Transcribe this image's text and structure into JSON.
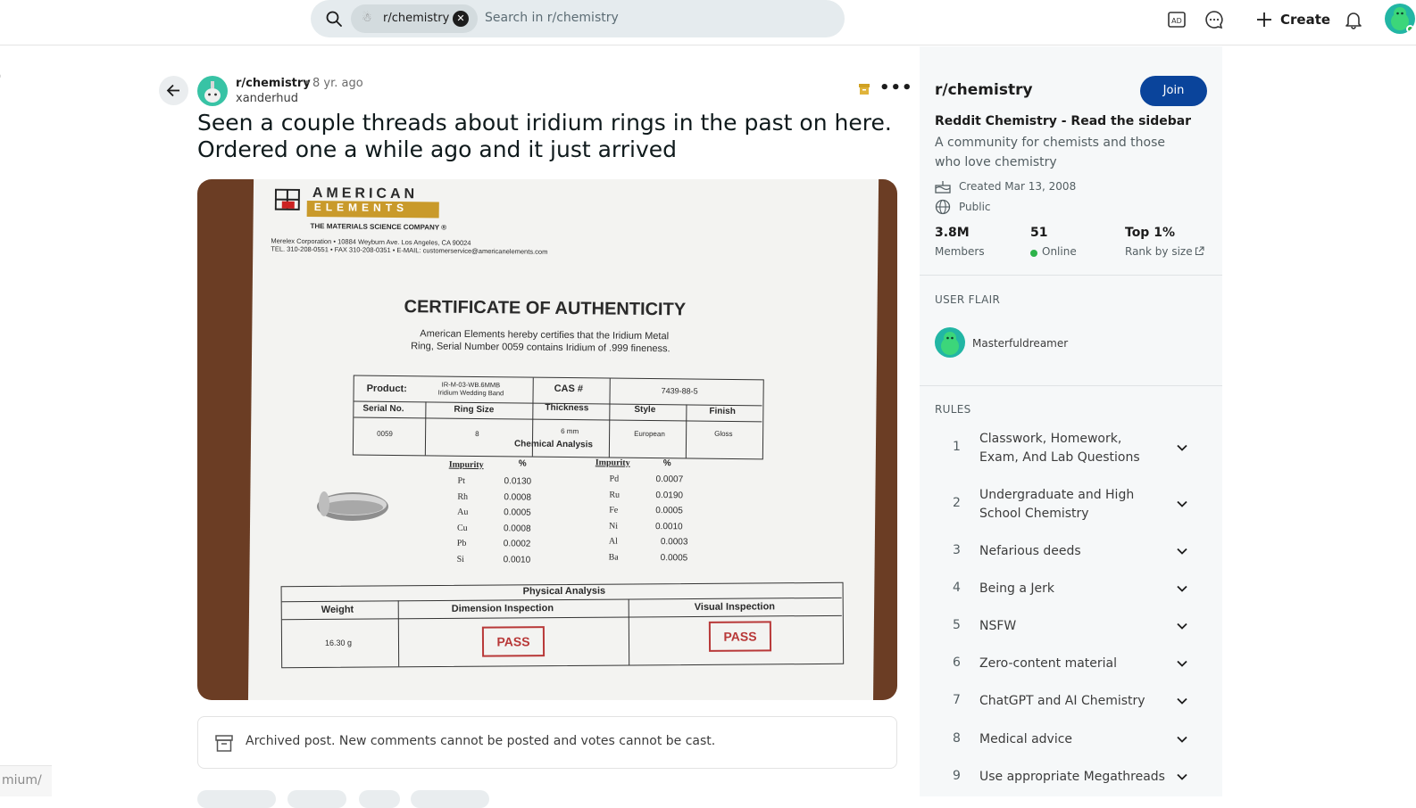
{
  "search": {
    "chip_label": "r/chemistry",
    "placeholder": "Search in r/chemistry"
  },
  "topbar": {
    "create_label": "Create",
    "icons": [
      "advertise-icon",
      "chat-icon",
      "plus-icon",
      "notification-bell-icon",
      "user-avatar"
    ]
  },
  "left_fragment": ")",
  "url_fragment": "mium/",
  "post": {
    "subreddit": "r/chemistry",
    "separator": "•",
    "age": "8 yr. ago",
    "author": "xanderhud",
    "title": "Seen a couple threads about iridium rings in the past on here. Ordered one a while ago and it just arrived",
    "archived_notice": "Archived post. New comments cannot be posted and votes cannot be cast."
  },
  "certificate": {
    "company_line1": "AMERICAN",
    "company_line2": "ELEMENTS",
    "tagline": "THE MATERIALS SCIENCE COMPANY ®",
    "address1": "Merelex Corporation  •  10884 Weyburn Ave. Los Angeles, CA 90024",
    "address2": "TEL. 310-208-0551 •  FAX 310-208-0351 • E-MAIL: customerservice@americanelements.com",
    "heading": "CERTIFICATE OF AUTHENTICITY",
    "statement1": "American Elements hereby certifies that the Iridium Metal",
    "statement2": "Ring, Serial Number 0059 contains Iridium of .999 fineness.",
    "product_label": "Product:",
    "product_value1": "IR-M-03-WB.6MMB",
    "product_value2": "Iridium Wedding Band",
    "cas_label": "CAS #",
    "cas_value": "7439-88-5",
    "headers": [
      "Serial No.",
      "Ring Size",
      "Thickness",
      "Style",
      "Finish"
    ],
    "values": [
      "0059",
      "8",
      "6 mm",
      "European",
      "Gloss"
    ],
    "chem_title": "Chemical Analysis",
    "impurity_label": "Impurity",
    "percent_label": "%",
    "impurities_left": [
      [
        "Pt",
        "0.0130"
      ],
      [
        "Rh",
        "0.0008"
      ],
      [
        "Au",
        "0.0005"
      ],
      [
        "Cu",
        "0.0008"
      ],
      [
        "Pb",
        "0.0002"
      ],
      [
        "Si",
        "0.0010"
      ]
    ],
    "impurities_right": [
      [
        "Pd",
        "0.0007"
      ],
      [
        "Ru",
        "0.0190"
      ],
      [
        "Fe",
        "0.0005"
      ],
      [
        "Ni",
        "0.0010"
      ],
      [
        "Al",
        "0.0003"
      ],
      [
        "Ba",
        "0.0005"
      ]
    ],
    "phys_title": "Physical Analysis",
    "weight_label": "Weight",
    "weight_value": "16.30 g",
    "dim_label": "Dimension Inspection",
    "vis_label": "Visual Inspection",
    "pass": "PASS"
  },
  "sidebar": {
    "name": "r/chemistry",
    "join_label": "Join",
    "title": "Reddit Chemistry - Read the sidebar",
    "description": "A community for chemists and those who love chemistry",
    "created": "Created Mar 13, 2008",
    "visibility": "Public",
    "members_value": "3.8M",
    "members_label": "Members",
    "online_value": "51",
    "online_label": "Online",
    "rank_value": "Top 1%",
    "rank_label": "Rank by size",
    "flair_heading": "USER FLAIR",
    "flair_user": "Masterfuldreamer",
    "rules_heading": "RULES",
    "rules": [
      {
        "num": "1",
        "text": "Classwork, Homework, Exam, And Lab Questions"
      },
      {
        "num": "2",
        "text": "Undergraduate and High School Chemistry"
      },
      {
        "num": "3",
        "text": "Nefarious deeds"
      },
      {
        "num": "4",
        "text": "Being a Jerk"
      },
      {
        "num": "5",
        "text": "NSFW"
      },
      {
        "num": "6",
        "text": "Zero-content material"
      },
      {
        "num": "7",
        "text": "ChatGPT and AI Chemistry"
      },
      {
        "num": "8",
        "text": "Medical advice"
      },
      {
        "num": "9",
        "text": "Use appropriate Megathreads"
      }
    ]
  },
  "colors": {
    "join_bg": "#0a449b",
    "online_dot": "#2db34a",
    "search_bg": "#e5ebee",
    "avatar_teal": "#22b6a4"
  }
}
